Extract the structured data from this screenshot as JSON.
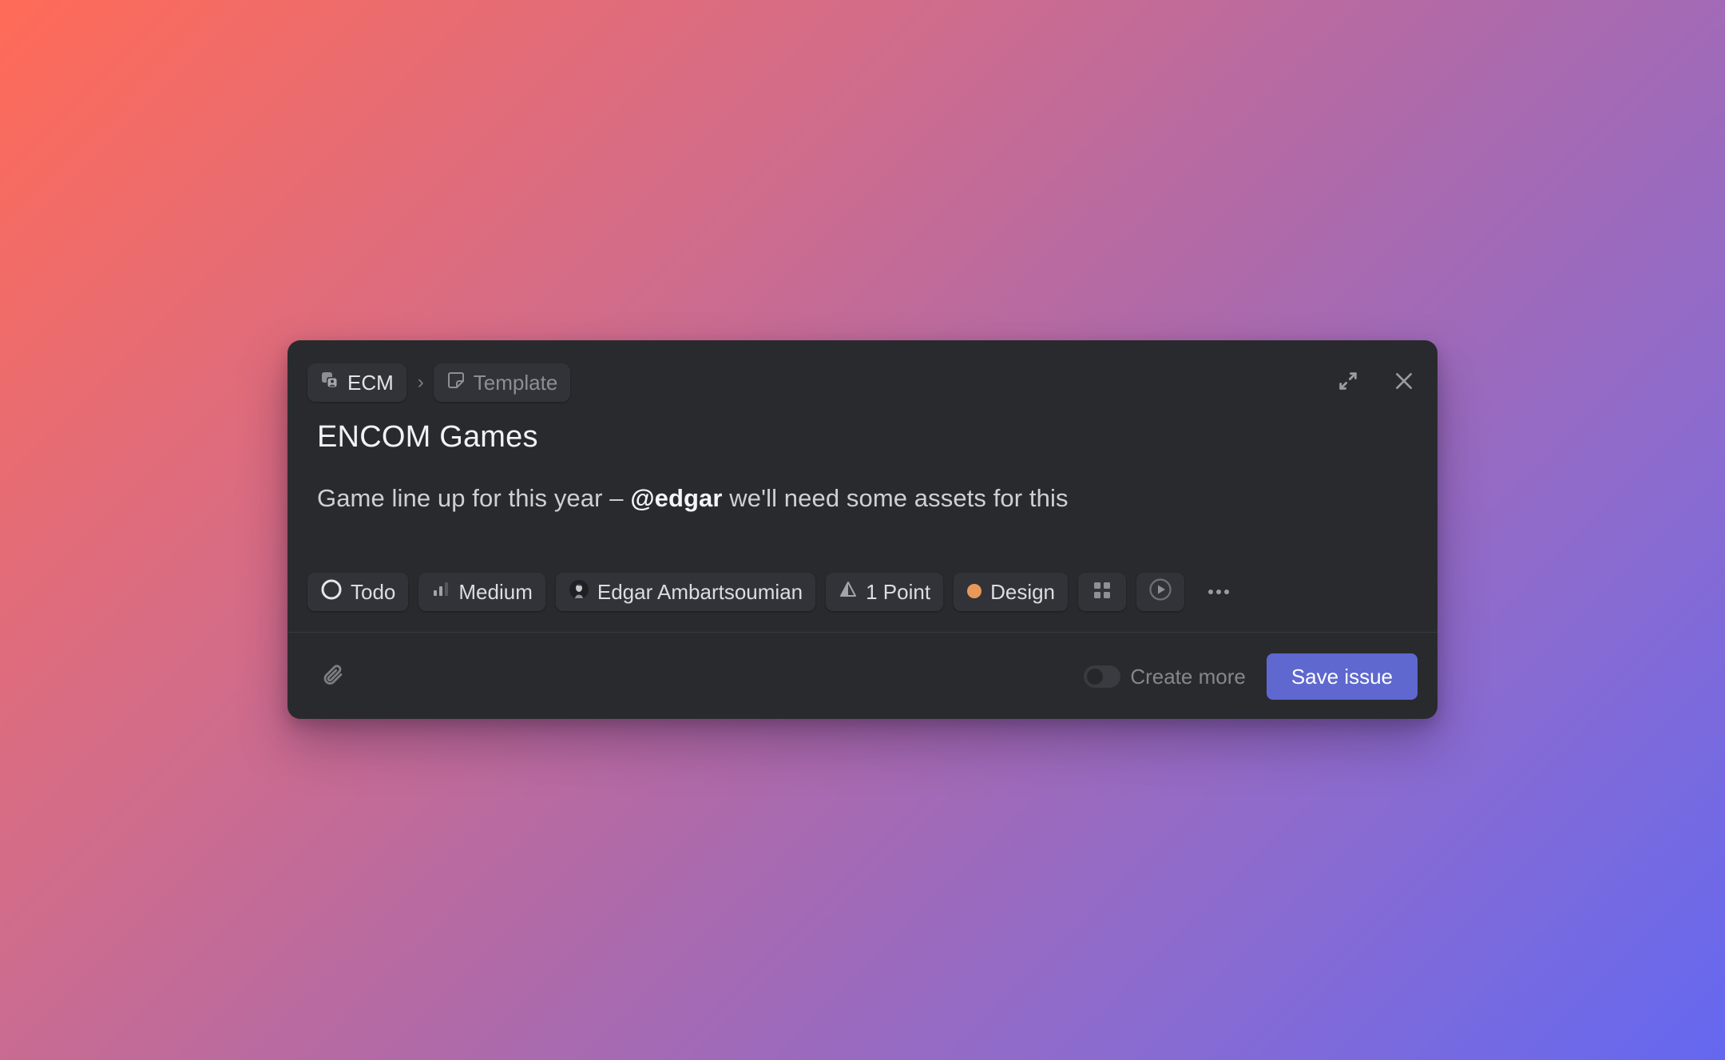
{
  "breadcrumb": {
    "team": {
      "label": "ECM",
      "icon": "team-icon"
    },
    "separator": "›",
    "template": {
      "label": "Template",
      "icon": "template-icon"
    }
  },
  "header_actions": {
    "expand_icon": "expand-icon",
    "close_icon": "close-icon"
  },
  "issue": {
    "title": "ENCOM Games",
    "description_before": "Game line up for this year – ",
    "mention": "@edgar",
    "description_after": " we'll need some assets for this"
  },
  "properties": {
    "status": {
      "label": "Todo",
      "icon": "todo-circle-icon"
    },
    "priority": {
      "label": "Medium",
      "icon": "priority-medium-icon",
      "level": 2,
      "max": 3
    },
    "assignee": {
      "label": "Edgar Ambartsoumian",
      "icon": "avatar"
    },
    "estimate": {
      "label": "1 Point",
      "icon": "estimate-icon"
    },
    "label": {
      "label": "Design",
      "icon": "label-dot",
      "color": "#e8995a"
    },
    "project_icon": "project-grid-icon",
    "cycle_icon": "cycle-play-icon",
    "more_icon": "more-icon"
  },
  "footer": {
    "attach_icon": "paperclip-icon",
    "create_more": {
      "label": "Create more",
      "enabled": false
    },
    "save_label": "Save issue"
  },
  "colors": {
    "accent": "#5e68cf",
    "modal_bg": "#292a2e",
    "pill_bg": "#323338",
    "label_design": "#e8995a",
    "bg_gradient_start": "#ff6b57",
    "bg_gradient_end": "#6468f0"
  }
}
